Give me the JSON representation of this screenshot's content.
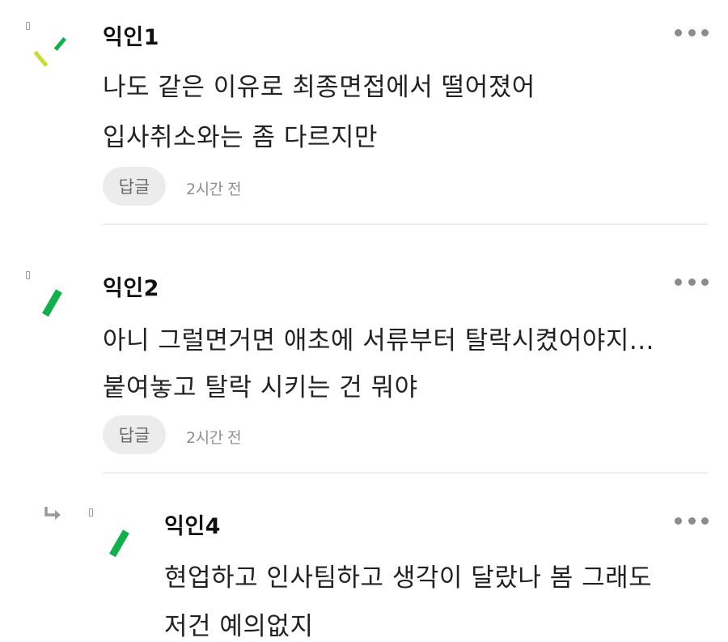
{
  "comments": [
    {
      "author": "익인1",
      "lines": [
        "나도 같은 이유로 최종면접에서 떨어졌어",
        "입사취소와는 좀 다르지만"
      ],
      "reply_label": "답글",
      "time": "2시간 전"
    },
    {
      "author": "익인2",
      "lines": [
        "아니 그럴면거면 애초에 서류부터 탈락시켰어야지...",
        "붙여놓고 탈락 시키는 건 뭐야"
      ],
      "reply_label": "답글",
      "time": "2시간 전"
    },
    {
      "author": "익인4",
      "lines": [
        "현업하고 인사팀하고 생각이 달랐나 봄 그래도",
        "저건 예의없지"
      ]
    }
  ],
  "colors": {
    "avatar_green": "#12b04a",
    "avatar_yellow": "#c9dd3a",
    "divider": "#ececec",
    "reply_bg": "#ececec"
  },
  "icons": [
    "more-options-icon",
    "reply-arrow-icon",
    "avatar-icon"
  ]
}
